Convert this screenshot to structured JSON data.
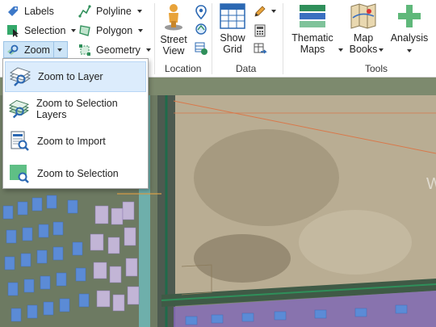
{
  "ribbon": {
    "small_buttons": {
      "labels": "Labels",
      "selection": "Selection",
      "zoom": "Zoom",
      "polyline": "Polyline",
      "polygon": "Polygon",
      "geometry": "Geometry"
    },
    "location": {
      "street_view": "Street View",
      "group_label": "Location"
    },
    "data": {
      "show_grid": "Show Grid",
      "group_label": "Data"
    },
    "tools": {
      "thematic_maps": "Thematic Maps",
      "map_books": "Map Books",
      "analysis": "Analysis",
      "group_label": "Tools"
    }
  },
  "zoom_menu": {
    "items": [
      {
        "label": "Zoom to Layer",
        "active": true
      },
      {
        "label": "Zoom to Selection Layers",
        "active": false
      },
      {
        "label": "Zoom to Import",
        "active": false
      },
      {
        "label": "Zoom to Selection",
        "active": false
      }
    ]
  },
  "map": {
    "watermark_letter": "W"
  },
  "colors": {
    "accent": "#0078d7",
    "menu_highlight": "#dcecfc",
    "building_blue": "#5b8bd6",
    "parcel_purple": "#8c6bc4",
    "road_green": "#2f8f5a"
  }
}
